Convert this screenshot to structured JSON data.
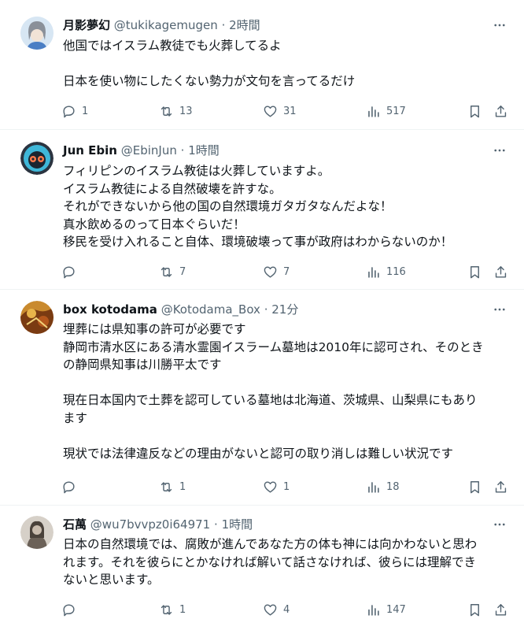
{
  "tweets": [
    {
      "name": "月影夢幻",
      "handle": "@tukikagemugen",
      "time": "2時間",
      "lines": [
        "他国ではイスラム教徒でも火葬してるよ",
        "",
        "日本を使い物にしたくない勢力が文句を言ってるだけ"
      ],
      "replies": "1",
      "retweets": "13",
      "likes": "31",
      "views": "517"
    },
    {
      "name": "Jun Ebin",
      "handle": "@EbinJun",
      "time": "1時間",
      "lines": [
        "フィリピンのイスラム教徒は火葬していますよ。",
        "イスラム教徒による自然破壊を許すな。",
        "それができないから他の国の自然環境ガタガタなんだよな！",
        "真水飲めるのって日本ぐらいだ！",
        "移民を受け入れること自体、環境破壊って事が政府はわからないのか！"
      ],
      "replies": "",
      "retweets": "7",
      "likes": "7",
      "views": "116"
    },
    {
      "name": "box kotodama",
      "handle": "@Kotodama_Box",
      "time": "21分",
      "lines": [
        "埋葬には県知事の許可が必要です",
        "静岡市清水区にある清水霊園イスラーム墓地は2010年に認可され、そのとき",
        "の静岡県知事は川勝平太です",
        "",
        "現在日本国内で土葬を認可している墓地は北海道、茨城県、山梨県にもあり",
        "ます",
        "",
        "現状では法律違反などの理由がないと認可の取り消しは難しい状況です"
      ],
      "replies": "",
      "retweets": "1",
      "likes": "1",
      "views": "18"
    },
    {
      "name": "石萬",
      "handle": "@wu7bvvpz0i64971",
      "time": "1時間",
      "lines": [
        "日本の自然環境では、腐敗が進んであなた方の体も神には向かわないと思わ",
        "れます。それを彼らにとかなければ解いて話さなければ、彼らには理解でき",
        "ないと思います。"
      ],
      "replies": "",
      "retweets": "1",
      "likes": "4",
      "views": "147"
    }
  ],
  "separator": "·",
  "colors": {
    "text": "#0f1419",
    "secondary": "#536471",
    "border": "#eff3f4"
  }
}
